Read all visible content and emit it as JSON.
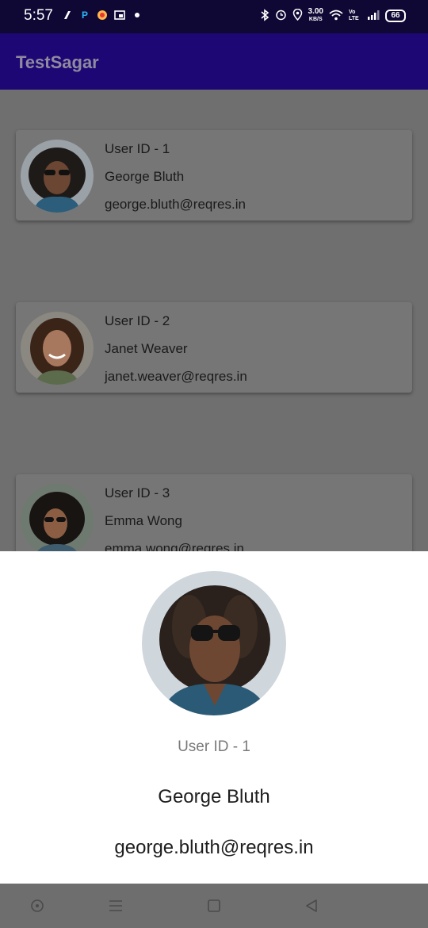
{
  "status_bar": {
    "time": "5:57",
    "speed_value": "3.00",
    "speed_unit": "KB/S",
    "network_label": "Vo LTE",
    "battery": "66",
    "icons": [
      "bluetooth-icon",
      "alarm-icon",
      "location-icon",
      "wifi-icon",
      "signal-icon",
      "battery-icon"
    ]
  },
  "app_bar": {
    "title": "TestSagar"
  },
  "users": [
    {
      "id_label": "User ID - 1",
      "name": "George Bluth",
      "email": "george.bluth@reqres.in"
    },
    {
      "id_label": "User ID - 2",
      "name": "Janet Weaver",
      "email": "janet.weaver@reqres.in"
    },
    {
      "id_label": "User ID - 3",
      "name": "Emma Wong",
      "email": "emma.wong@reqres.in"
    }
  ],
  "bottom_sheet": {
    "id_label": "User ID - 1",
    "name": "George Bluth",
    "email": "george.bluth@reqres.in"
  },
  "nav_bar": {
    "icons": [
      "recents-icon",
      "menu-icon",
      "home-icon",
      "back-icon"
    ]
  },
  "colors": {
    "app_bar": "#1d0774",
    "status_bar": "#0f0835",
    "scrim": "#6f6f6f",
    "sheet": "#ffffff"
  }
}
